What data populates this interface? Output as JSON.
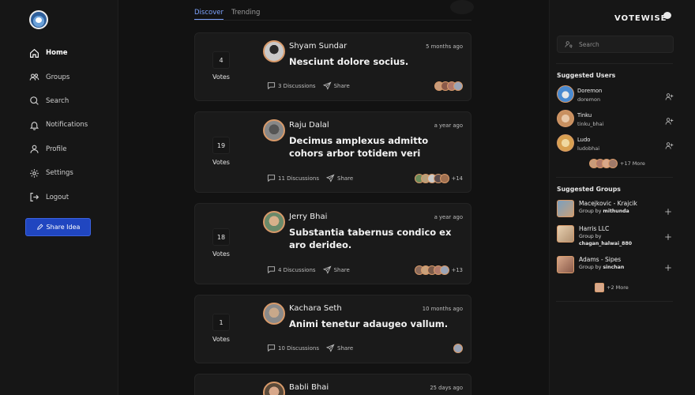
{
  "nav": {
    "items": [
      {
        "label": "Home",
        "icon": "home-icon",
        "active": true
      },
      {
        "label": "Groups",
        "icon": "groups-icon"
      },
      {
        "label": "Search",
        "icon": "search-icon"
      },
      {
        "label": "Notifications",
        "icon": "bell-icon"
      },
      {
        "label": "Profile",
        "icon": "user-icon"
      },
      {
        "label": "Settings",
        "icon": "gear-icon"
      },
      {
        "label": "Logout",
        "icon": "logout-icon"
      }
    ],
    "share_button": "Share Idea"
  },
  "tabs": [
    {
      "label": "Discover",
      "active": true
    },
    {
      "label": "Trending"
    }
  ],
  "posts": [
    {
      "votes": "4",
      "votes_label": "Votes",
      "author": "Shyam Sundar",
      "time": "5 months ago",
      "title": "Nesciunt dolore socius.",
      "discussions": "3 Discussions",
      "share": "Share",
      "more": ""
    },
    {
      "votes": "19",
      "votes_label": "Votes",
      "author": "Raju Dalal",
      "time": "a year ago",
      "title": "Decimus amplexus admitto cohors arbor totidem veri",
      "discussions": "11 Discussions",
      "share": "Share",
      "more": "+14"
    },
    {
      "votes": "18",
      "votes_label": "Votes",
      "author": "Jerry Bhai",
      "time": "a year ago",
      "title": "Substantia tabernus condico ex aro derideo.",
      "discussions": "4 Discussions",
      "share": "Share",
      "more": "+13"
    },
    {
      "votes": "1",
      "votes_label": "Votes",
      "author": "Kachara Seth",
      "time": "10 months ago",
      "title": "Animi tenetur adaugeo vallum.",
      "discussions": "10 Discussions",
      "share": "Share",
      "more": ""
    },
    {
      "author": "Babli Bhai",
      "time": "25 days ago"
    }
  ],
  "sidebar": {
    "brand": "VOTEWISE",
    "search_placeholder": "Search",
    "suggested_users_title": "Suggested Users",
    "users": [
      {
        "name": "Doremon",
        "handle": "doremon"
      },
      {
        "name": "Tinku",
        "handle": "tinku_bhai"
      },
      {
        "name": "Ludo",
        "handle": "ludobhai"
      }
    ],
    "users_more": "+17 More",
    "suggested_groups_title": "Suggested Groups",
    "groups": [
      {
        "name": "Macejkovic - Krajcik",
        "by_prefix": "Group by",
        "owner": "mithunda"
      },
      {
        "name": "Harris LLC",
        "by_prefix": "Group by",
        "owner": "chagan_halwai_880"
      },
      {
        "name": "Adams - Sipes",
        "by_prefix": "Group by",
        "owner": "sinchan"
      }
    ],
    "groups_more": "+2 More"
  },
  "colors": {
    "background": "#121212",
    "panel": "#1a1a1a",
    "accent_blue": "#2046c0",
    "tab_active": "#7da4ff",
    "avatar_ring": "#d89a6a"
  }
}
